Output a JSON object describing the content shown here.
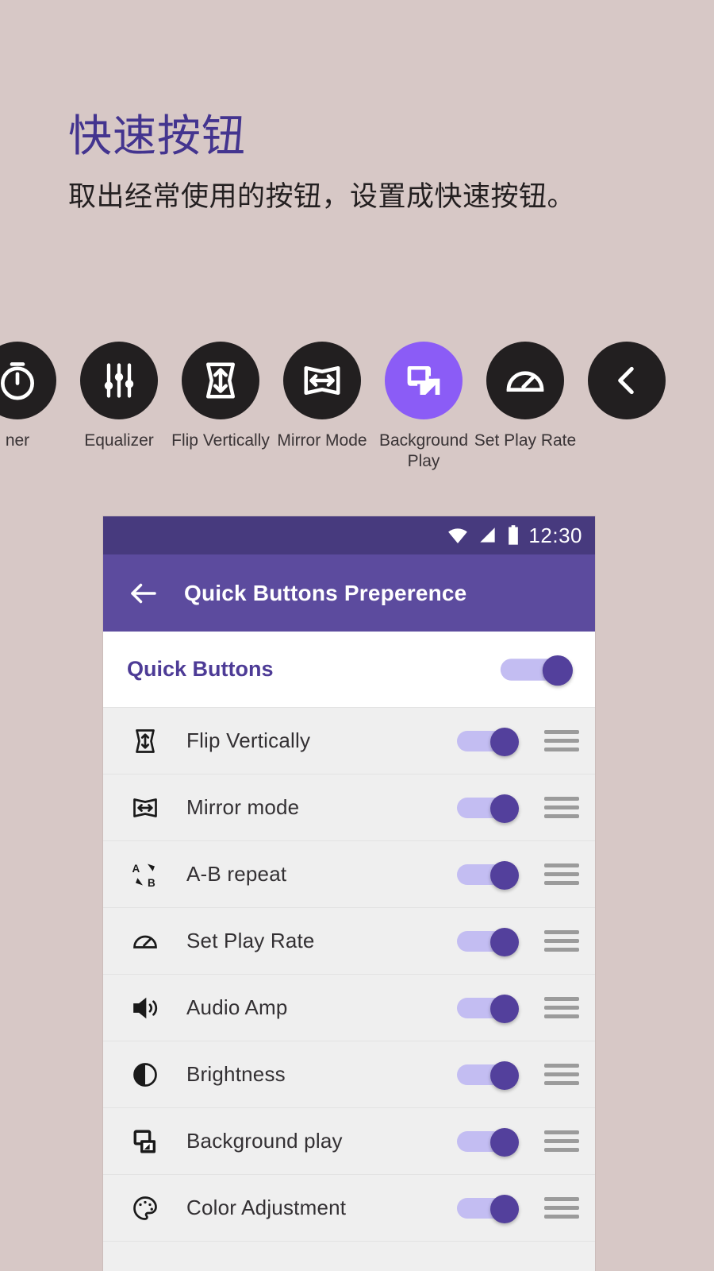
{
  "promo": {
    "headline": "快速按钮",
    "subhead": "取出经常使用的按钮，设置成快速按钮。"
  },
  "colors": {
    "background": "#d7c8c6",
    "headline": "#43348f",
    "icon_circle": "#221f20",
    "icon_circle_active": "#8b5cf6",
    "appbar": "#5c4b9e",
    "statusbar": "#473a7e",
    "toggle_thumb": "#53409c",
    "toggle_track": "#c3bdf2",
    "master_label": "#4d3b96",
    "drag_handle": "#9b9b9b"
  },
  "icon_strip": [
    {
      "label": "ner",
      "icon": "sleep-timer-icon",
      "active": false,
      "clipped": true
    },
    {
      "label": "Equalizer",
      "icon": "equalizer-icon",
      "active": false
    },
    {
      "label": "Flip Vertically",
      "icon": "flip-vertically-icon",
      "active": false
    },
    {
      "label": "Mirror Mode",
      "icon": "mirror-mode-icon",
      "active": false
    },
    {
      "label": "Background Play",
      "icon": "background-play-icon",
      "active": true
    },
    {
      "label": "Set Play Rate",
      "icon": "set-play-rate-icon",
      "active": false
    },
    {
      "label": "",
      "icon": "chevron-left-icon",
      "active": false
    }
  ],
  "phone": {
    "statusbar": {
      "time": "12:30",
      "icons": [
        "wifi-icon",
        "signal-icon",
        "battery-icon"
      ]
    },
    "appbar": {
      "back_icon": "back-arrow-icon",
      "title": "Quick Buttons Preperence"
    },
    "master": {
      "label": "Quick Buttons",
      "enabled": true
    },
    "rows": [
      {
        "label": "Flip Vertically",
        "icon": "flip-vertically-icon",
        "enabled": true
      },
      {
        "label": "Mirror mode",
        "icon": "mirror-mode-icon",
        "enabled": true
      },
      {
        "label": "A-B repeat",
        "icon": "ab-repeat-icon",
        "enabled": true
      },
      {
        "label": "Set Play Rate",
        "icon": "set-play-rate-icon",
        "enabled": true
      },
      {
        "label": "Audio Amp",
        "icon": "audio-amp-icon",
        "enabled": true
      },
      {
        "label": "Brightness",
        "icon": "brightness-icon",
        "enabled": true
      },
      {
        "label": "Background play",
        "icon": "background-play-icon",
        "enabled": true
      },
      {
        "label": "Color Adjustment",
        "icon": "color-adjustment-icon",
        "enabled": true
      }
    ]
  }
}
